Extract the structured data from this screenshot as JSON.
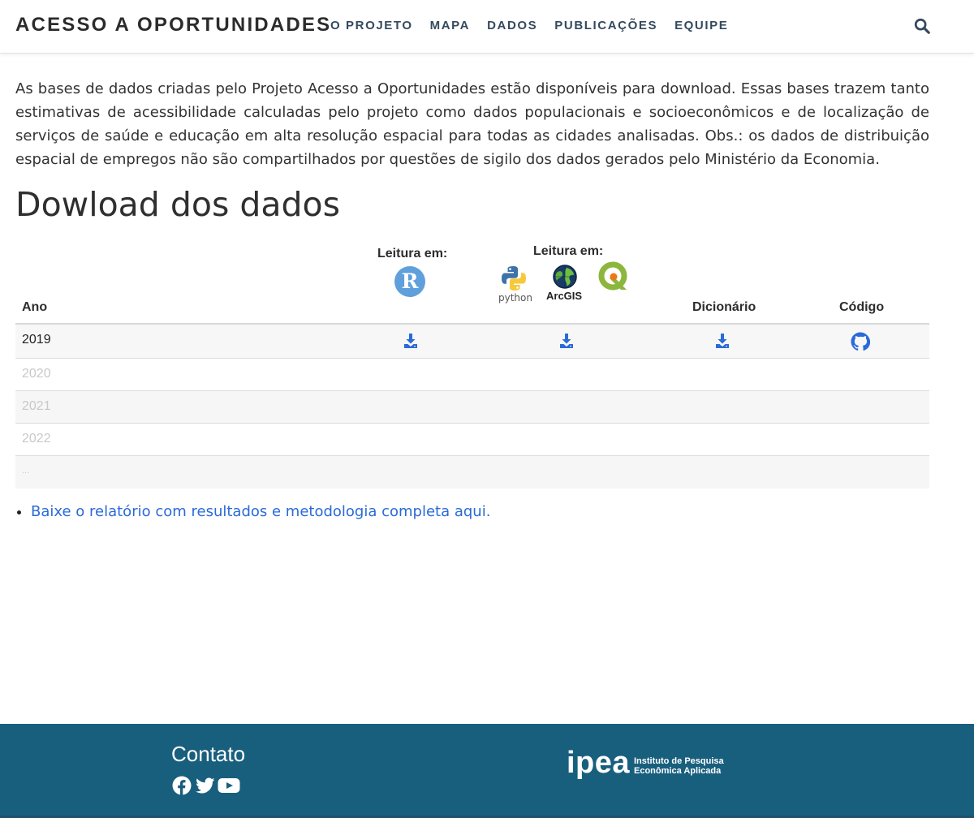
{
  "header": {
    "brand": "ACESSO A OPORTUNIDADES",
    "nav": [
      "O PROJETO",
      "MAPA",
      "DADOS",
      "PUBLICAÇÕES",
      "EQUIPE"
    ],
    "search_icon": "search-icon"
  },
  "intro": {
    "text": "As bases de dados criadas pelo Projeto Acesso a Oportunidades estão disponíveis para download. Essas bases trazem tanto estimativas de acessibilidade calculadas pelo projeto como dados populacionais e socioeconômicos e de localização de serviços de saúde e educação em alta resolução espacial para todas as cidades analisadas. Obs.: os dados de distribuição espacial de empregos não são compartilhados por questões de sigilo dos dados gerados pelo Ministério da Economia."
  },
  "page_title": "Dowload dos dados",
  "table": {
    "headers": {
      "ano": "Ano",
      "leitura_r": "Leitura em:",
      "leitura_py": "Leitura em:",
      "dicionario": "Dicionário",
      "codigo": "Código"
    },
    "logos": {
      "r": "R",
      "python": "python",
      "arcgis": "ArcGIS",
      "qgis_icon": "qgis-icon"
    },
    "rows": [
      {
        "year": "2019",
        "available": true
      },
      {
        "year": "2020",
        "available": false
      },
      {
        "year": "2021",
        "available": false
      },
      {
        "year": "2022",
        "available": false
      },
      {
        "year": "...",
        "available": false
      }
    ]
  },
  "links": {
    "report": "Baixe o relatório com resultados e metodologia completa aqui."
  },
  "footer": {
    "contact": "Contato",
    "social": [
      "facebook-icon",
      "twitter-icon",
      "youtube-icon"
    ],
    "ipea_word": "ipea",
    "ipea_line1": "Instituto de Pesquisa",
    "ipea_line2": "Econômica Aplicada"
  },
  "colors": {
    "accent": "#2a6ad9",
    "footer_bg": "#185f7e",
    "nav_text": "#34495e"
  }
}
